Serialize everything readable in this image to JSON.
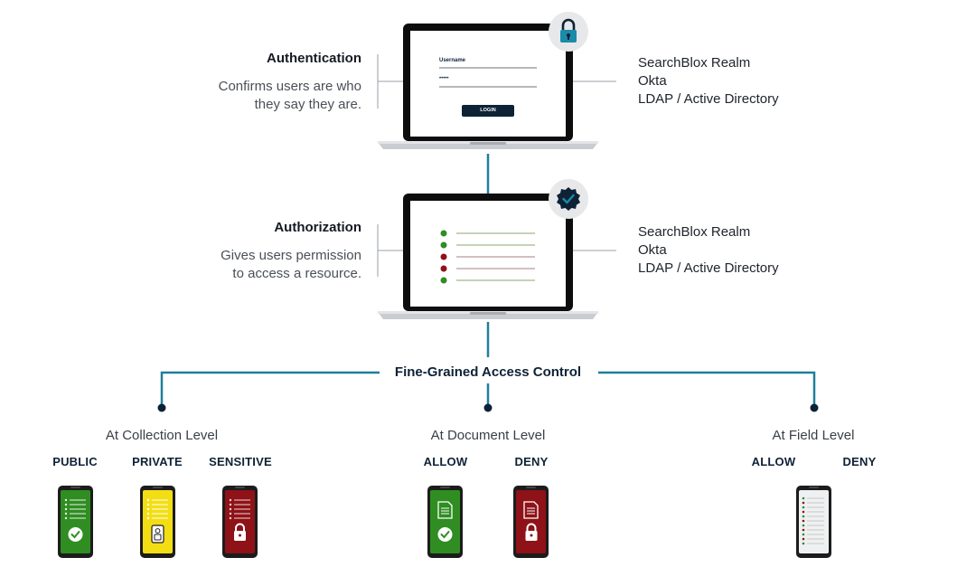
{
  "authentication": {
    "title": "Authentication",
    "description_line1": "Confirms users are who",
    "description_line2": "they say they are.",
    "providers": [
      "SearchBlox Realm",
      "Okta",
      "LDAP / Active Directory"
    ],
    "login_form": {
      "username_label": "Username",
      "password_mask": "•••••",
      "login_button": "LOGIN"
    },
    "badge_icon": "lock-icon"
  },
  "authorization": {
    "title": "Authorization",
    "description_line1": "Gives users permission",
    "description_line2": "to access a resource.",
    "providers": [
      "SearchBlox Realm",
      "Okta",
      "LDAP / Active Directory"
    ],
    "badge_icon": "verified-badge-icon",
    "permission_rows": [
      "allow",
      "allow",
      "deny",
      "deny",
      "allow"
    ]
  },
  "fine_grained": {
    "title": "Fine-Grained Access Control",
    "levels": [
      {
        "title": "At Collection Level",
        "labels": [
          "PUBLIC",
          "PRIVATE",
          "SENSITIVE"
        ]
      },
      {
        "title": "At Document Level",
        "labels": [
          "ALLOW",
          "DENY"
        ]
      },
      {
        "title": "At Field Level",
        "labels": [
          "ALLOW",
          "DENY"
        ]
      }
    ]
  },
  "colors": {
    "connector": "#1f7f9a",
    "allow_green": "#2f8d22",
    "private_yellow": "#f3de14",
    "deny_red": "#8e1217",
    "navy": "#0e2236"
  }
}
